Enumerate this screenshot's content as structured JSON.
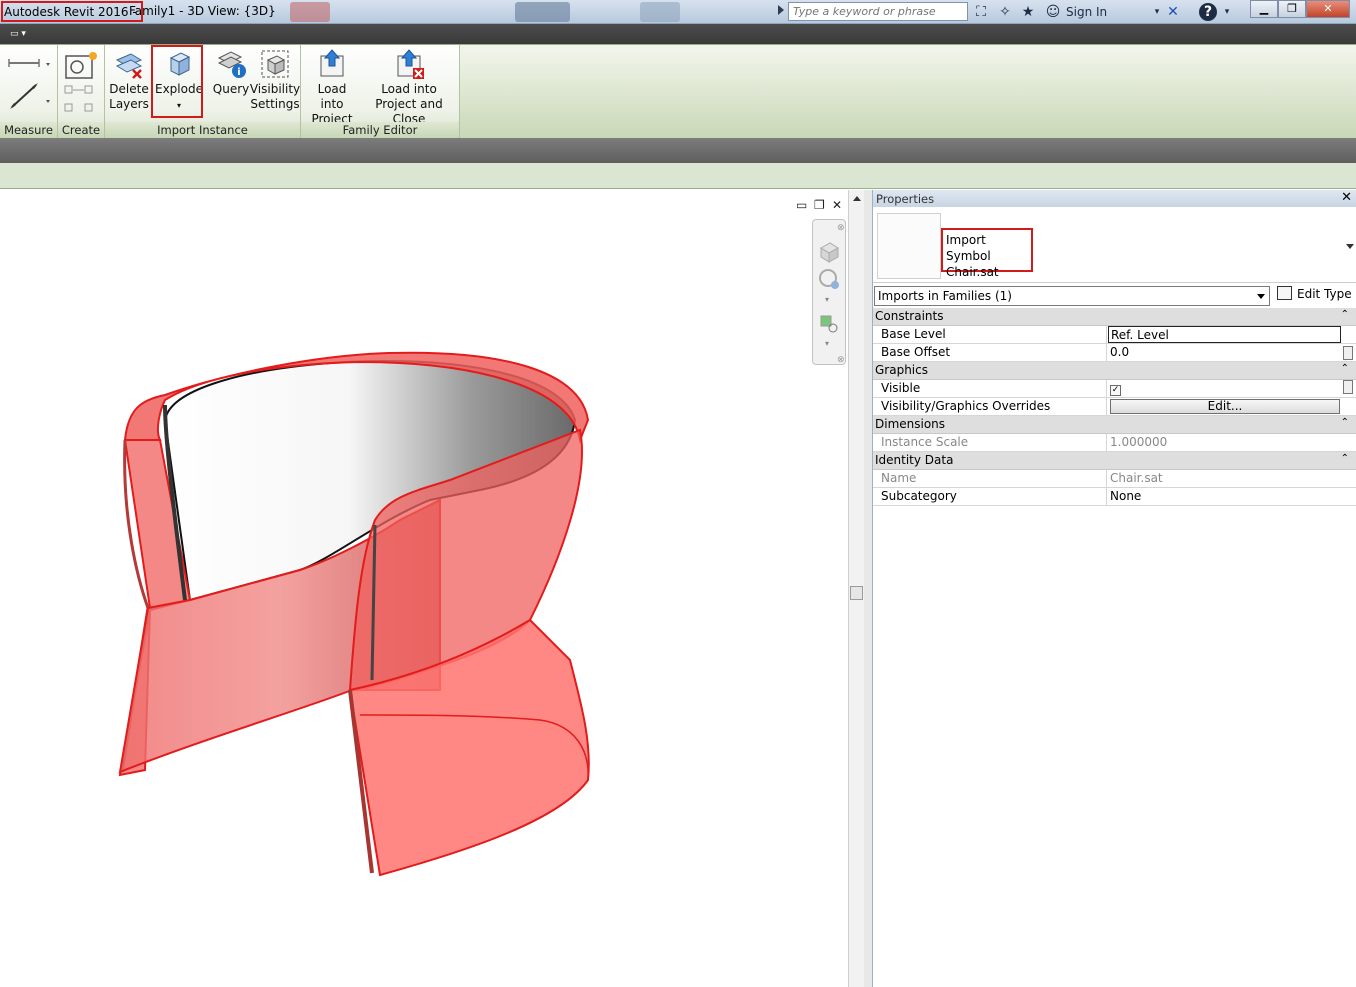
{
  "window": {
    "app_title": "Autodesk Revit 2016 -",
    "doc_title": "Family1 - 3D View: {3D}",
    "search_placeholder": "Type a keyword or phrase",
    "sign_in": "Sign In"
  },
  "ribbon": {
    "measure": {
      "label": "Measure"
    },
    "create": {
      "label": "Create"
    },
    "import_instance": {
      "label": "Import Instance",
      "delete_layers_1": "Delete",
      "delete_layers_2": "Layers",
      "explode": "Explode",
      "query": "Query",
      "visibility_1": "Visibility",
      "visibility_2": "Settings"
    },
    "family_editor": {
      "label": "Family Editor",
      "load_project_1": "Load into",
      "load_project_2": "Project",
      "load_close_1": "Load into",
      "load_close_2": "Project and Close"
    }
  },
  "properties": {
    "title": "Properties",
    "type_line1": "Import Symbol",
    "type_line2": "Chair.sat",
    "selector": "Imports in Families (1)",
    "edit_type": "Edit Type",
    "groups": {
      "constraints": "Constraints",
      "graphics": "Graphics",
      "dimensions": "Dimensions",
      "identity": "Identity Data"
    },
    "rows": {
      "base_level": {
        "key": "Base Level",
        "value": "Ref. Level"
      },
      "base_offset": {
        "key": "Base Offset",
        "value": "0.0"
      },
      "visible": {
        "key": "Visible",
        "value": "✓"
      },
      "vg_overrides": {
        "key": "Visibility/Graphics Overrides",
        "value": "Edit..."
      },
      "instance_scale": {
        "key": "Instance Scale",
        "value": "1.000000"
      },
      "name": {
        "key": "Name",
        "value": "Chair.sat"
      },
      "subcategory": {
        "key": "Subcategory",
        "value": "None"
      }
    }
  },
  "colors": {
    "highlight": "#d21a1a",
    "chair_fill": "#f0605e",
    "chair_edge": "#e31b1b"
  }
}
